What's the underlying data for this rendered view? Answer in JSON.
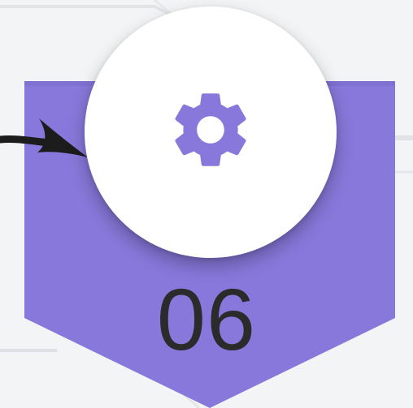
{
  "step": {
    "number": "06",
    "icon": "gear-icon"
  },
  "colors": {
    "background": "#f3f4f6",
    "banner": "#8878db",
    "circle": "#ffffff",
    "gear": "#8878db",
    "number": "#2b2b2b",
    "arrow": "#1c1c1c"
  }
}
